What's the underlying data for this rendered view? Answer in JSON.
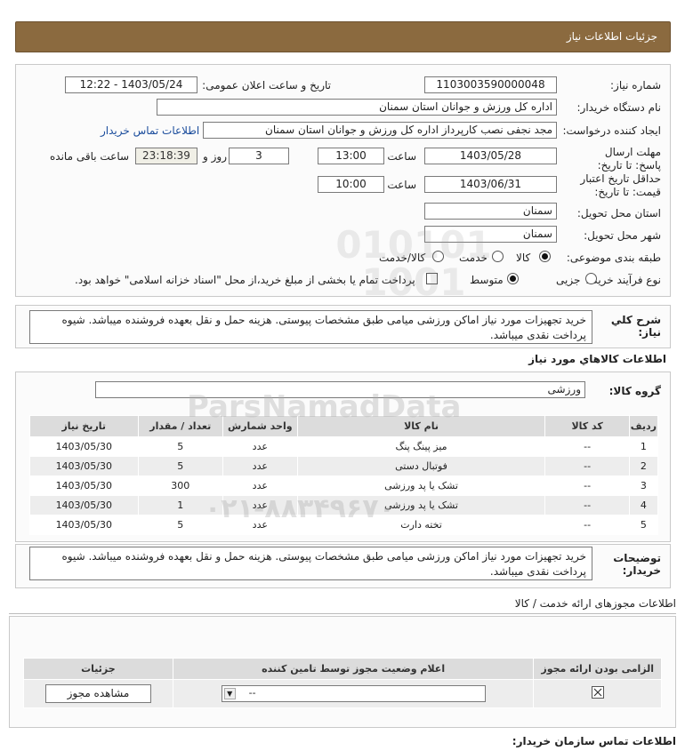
{
  "header": {
    "title": "جزئیات اطلاعات نیاز"
  },
  "form": {
    "need_number_label": "شماره نیاز:",
    "need_number": "1103003590000048",
    "announce_label": "تاریخ و ساعت اعلان عمومی:",
    "announce_value": "1403/05/24 - 12:22",
    "buyer_label": "نام دستگاه خریدار:",
    "buyer_value": "اداره کل ورزش و جوانان استان سمنان",
    "creator_label": "ایجاد کننده درخواست:",
    "creator_value": "مجد نجفی نصب کارپرداز اداره کل ورزش و جوانان استان سمنان",
    "contact_link": "اطلاعات تماس خریدار",
    "deadline_label": "مهلت ارسال پاسخ: تا تاریخ:",
    "deadline_date": "1403/05/28",
    "time_label": "ساعت",
    "deadline_time": "13:00",
    "days_value": "3",
    "days_label": "روز و",
    "remaining_value": "23:18:39",
    "remaining_label": "ساعت باقی مانده",
    "validity_label": "حداقل تاریخ اعتبار قیمت: تا تاریخ:",
    "validity_date": "1403/06/31",
    "validity_time": "10:00",
    "province_label": "استان محل تحویل:",
    "province_value": "سمنان",
    "city_label": "شهر محل تحویل:",
    "city_value": "سمنان",
    "category_label": "طبقه بندی موضوعی:",
    "category_options": [
      "کالا",
      "خدمت",
      "کالا/خدمت"
    ],
    "category_selected": "کالا",
    "process_label": "نوع فرآیند خرید :",
    "process_options": [
      "جزیی",
      "متوسط"
    ],
    "process_selected": "متوسط",
    "payment_note": "پرداخت تمام یا بخشی از مبلغ خرید،از محل \"اسناد خزانه اسلامی\" خواهد بود."
  },
  "summary": {
    "label": "شرح کلي نياز:",
    "text": "خرید تجهیزات مورد نیاز اماکن ورزشی میامی طبق مشخصات پیوستی. هزینه حمل و نقل بعهده فروشنده میباشد. شیوه پرداخت نقدی میباشد."
  },
  "goods": {
    "section_title": "اطلاعات کالاهاي مورد نياز",
    "group_label": "گروه کالا:",
    "group_value": "ورزشی",
    "columns": [
      "ردیف",
      "کد کالا",
      "نام کالا",
      "واحد شمارش",
      "تعداد / مقدار",
      "تاریخ نیاز"
    ],
    "rows": [
      [
        "1",
        "--",
        "میز پینگ پنگ",
        "عدد",
        "5",
        "1403/05/30"
      ],
      [
        "2",
        "--",
        "فوتبال دستی",
        "عدد",
        "5",
        "1403/05/30"
      ],
      [
        "3",
        "--",
        "تشک یا پد ورزشی",
        "عدد",
        "300",
        "1403/05/30"
      ],
      [
        "4",
        "--",
        "تشک یا پد ورزشی",
        "عدد",
        "1",
        "1403/05/30"
      ],
      [
        "5",
        "--",
        "تخته دارت",
        "عدد",
        "5",
        "1403/05/30"
      ]
    ]
  },
  "buyer_notes": {
    "label": "توضیحات خریدار:",
    "text": "خرید تجهیزات مورد نیاز اماکن ورزشی میامی طبق مشخصات پیوستی. هزینه حمل و نقل بعهده فروشنده میباشد. شیوه پرداخت نقدی میباشد."
  },
  "permits": {
    "section_title": "اطلاعات مجوزهای ارائه خدمت / کالا",
    "columns": [
      "الزامی بودن ارائه مجوز",
      "اعلام وضعیت مجوز توسط تامین کننده",
      "جزئیات"
    ],
    "select_value": "--",
    "view_button": "مشاهده مجوز"
  },
  "footer": {
    "contact_title": "اطلاعات تماس سازمان خریدار:"
  },
  "watermark": {
    "brand": "ParsNamadData",
    "digits": "۰۲۱-۸۸۳۴۹۶۷۰"
  }
}
